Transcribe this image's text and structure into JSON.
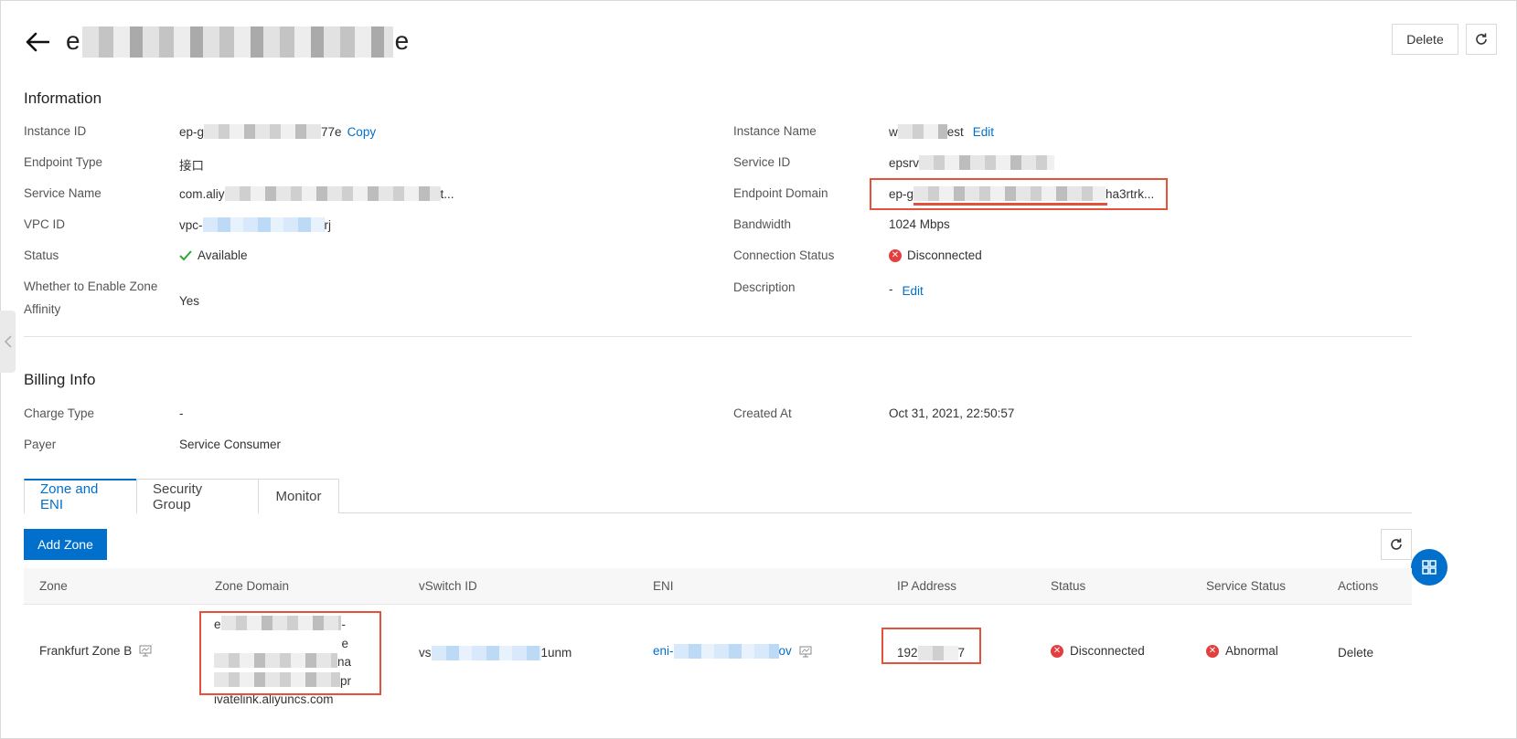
{
  "header": {
    "title_prefix": "e",
    "title_suffix": "e",
    "delete_label": "Delete"
  },
  "information": {
    "section_title": "Information",
    "left": [
      {
        "label": "Instance ID",
        "value_prefix": "ep-g",
        "value_suffix": "77e",
        "action": "Copy"
      },
      {
        "label": "Endpoint Type",
        "value": "接口"
      },
      {
        "label": "Service Name",
        "value_prefix": "com.aliy",
        "value_suffix": "t..."
      },
      {
        "label": "VPC ID",
        "value_prefix": "vpc-",
        "value_suffix": "rj"
      },
      {
        "label": "Status",
        "value": "Available"
      },
      {
        "label": "Whether to Enable Zone Affinity",
        "value": "Yes"
      }
    ],
    "right": [
      {
        "label": "Instance Name",
        "value_prefix": "w",
        "value_suffix": "est",
        "action": "Edit"
      },
      {
        "label": "Service ID",
        "value_prefix": "epsrv"
      },
      {
        "label": "Endpoint Domain",
        "value_prefix": "ep-g",
        "value_suffix": "ha3rtrk..."
      },
      {
        "label": "Bandwidth",
        "value": "1024 Mbps"
      },
      {
        "label": "Connection Status",
        "value": "Disconnected"
      },
      {
        "label": "Description",
        "value": "-",
        "action": "Edit"
      }
    ]
  },
  "billing": {
    "section_title": "Billing Info",
    "charge_type_label": "Charge Type",
    "charge_type_value": "-",
    "payer_label": "Payer",
    "payer_value": "Service Consumer",
    "created_at_label": "Created At",
    "created_at_value": "Oct 31, 2021, 22:50:57"
  },
  "tabs": [
    "Zone and ENI",
    "Security Group",
    "Monitor"
  ],
  "add_zone_label": "Add Zone",
  "table": {
    "columns": [
      "Zone",
      "Zone Domain",
      "vSwitch ID",
      "ENI",
      "IP Address",
      "Status",
      "Service Status",
      "Actions"
    ],
    "row": {
      "zone": "Frankfurt Zone B",
      "zone_domain_lines": [
        "e",
        "na",
        "pr",
        "ivatelink.aliyuncs.com"
      ],
      "zone_domain_line1_suffix": "-e",
      "vswitch_prefix": "vs",
      "vswitch_suffix": "1unm",
      "eni_prefix": "eni-",
      "eni_suffix": "ov",
      "ip_prefix": "192",
      "ip_suffix": "7",
      "status": "Disconnected",
      "service_status": "Abnormal",
      "action": "Delete"
    }
  },
  "colors": {
    "accent": "#0070cc",
    "highlight": "#e5523a",
    "error": "#e53e3e",
    "success": "#2fa836"
  }
}
